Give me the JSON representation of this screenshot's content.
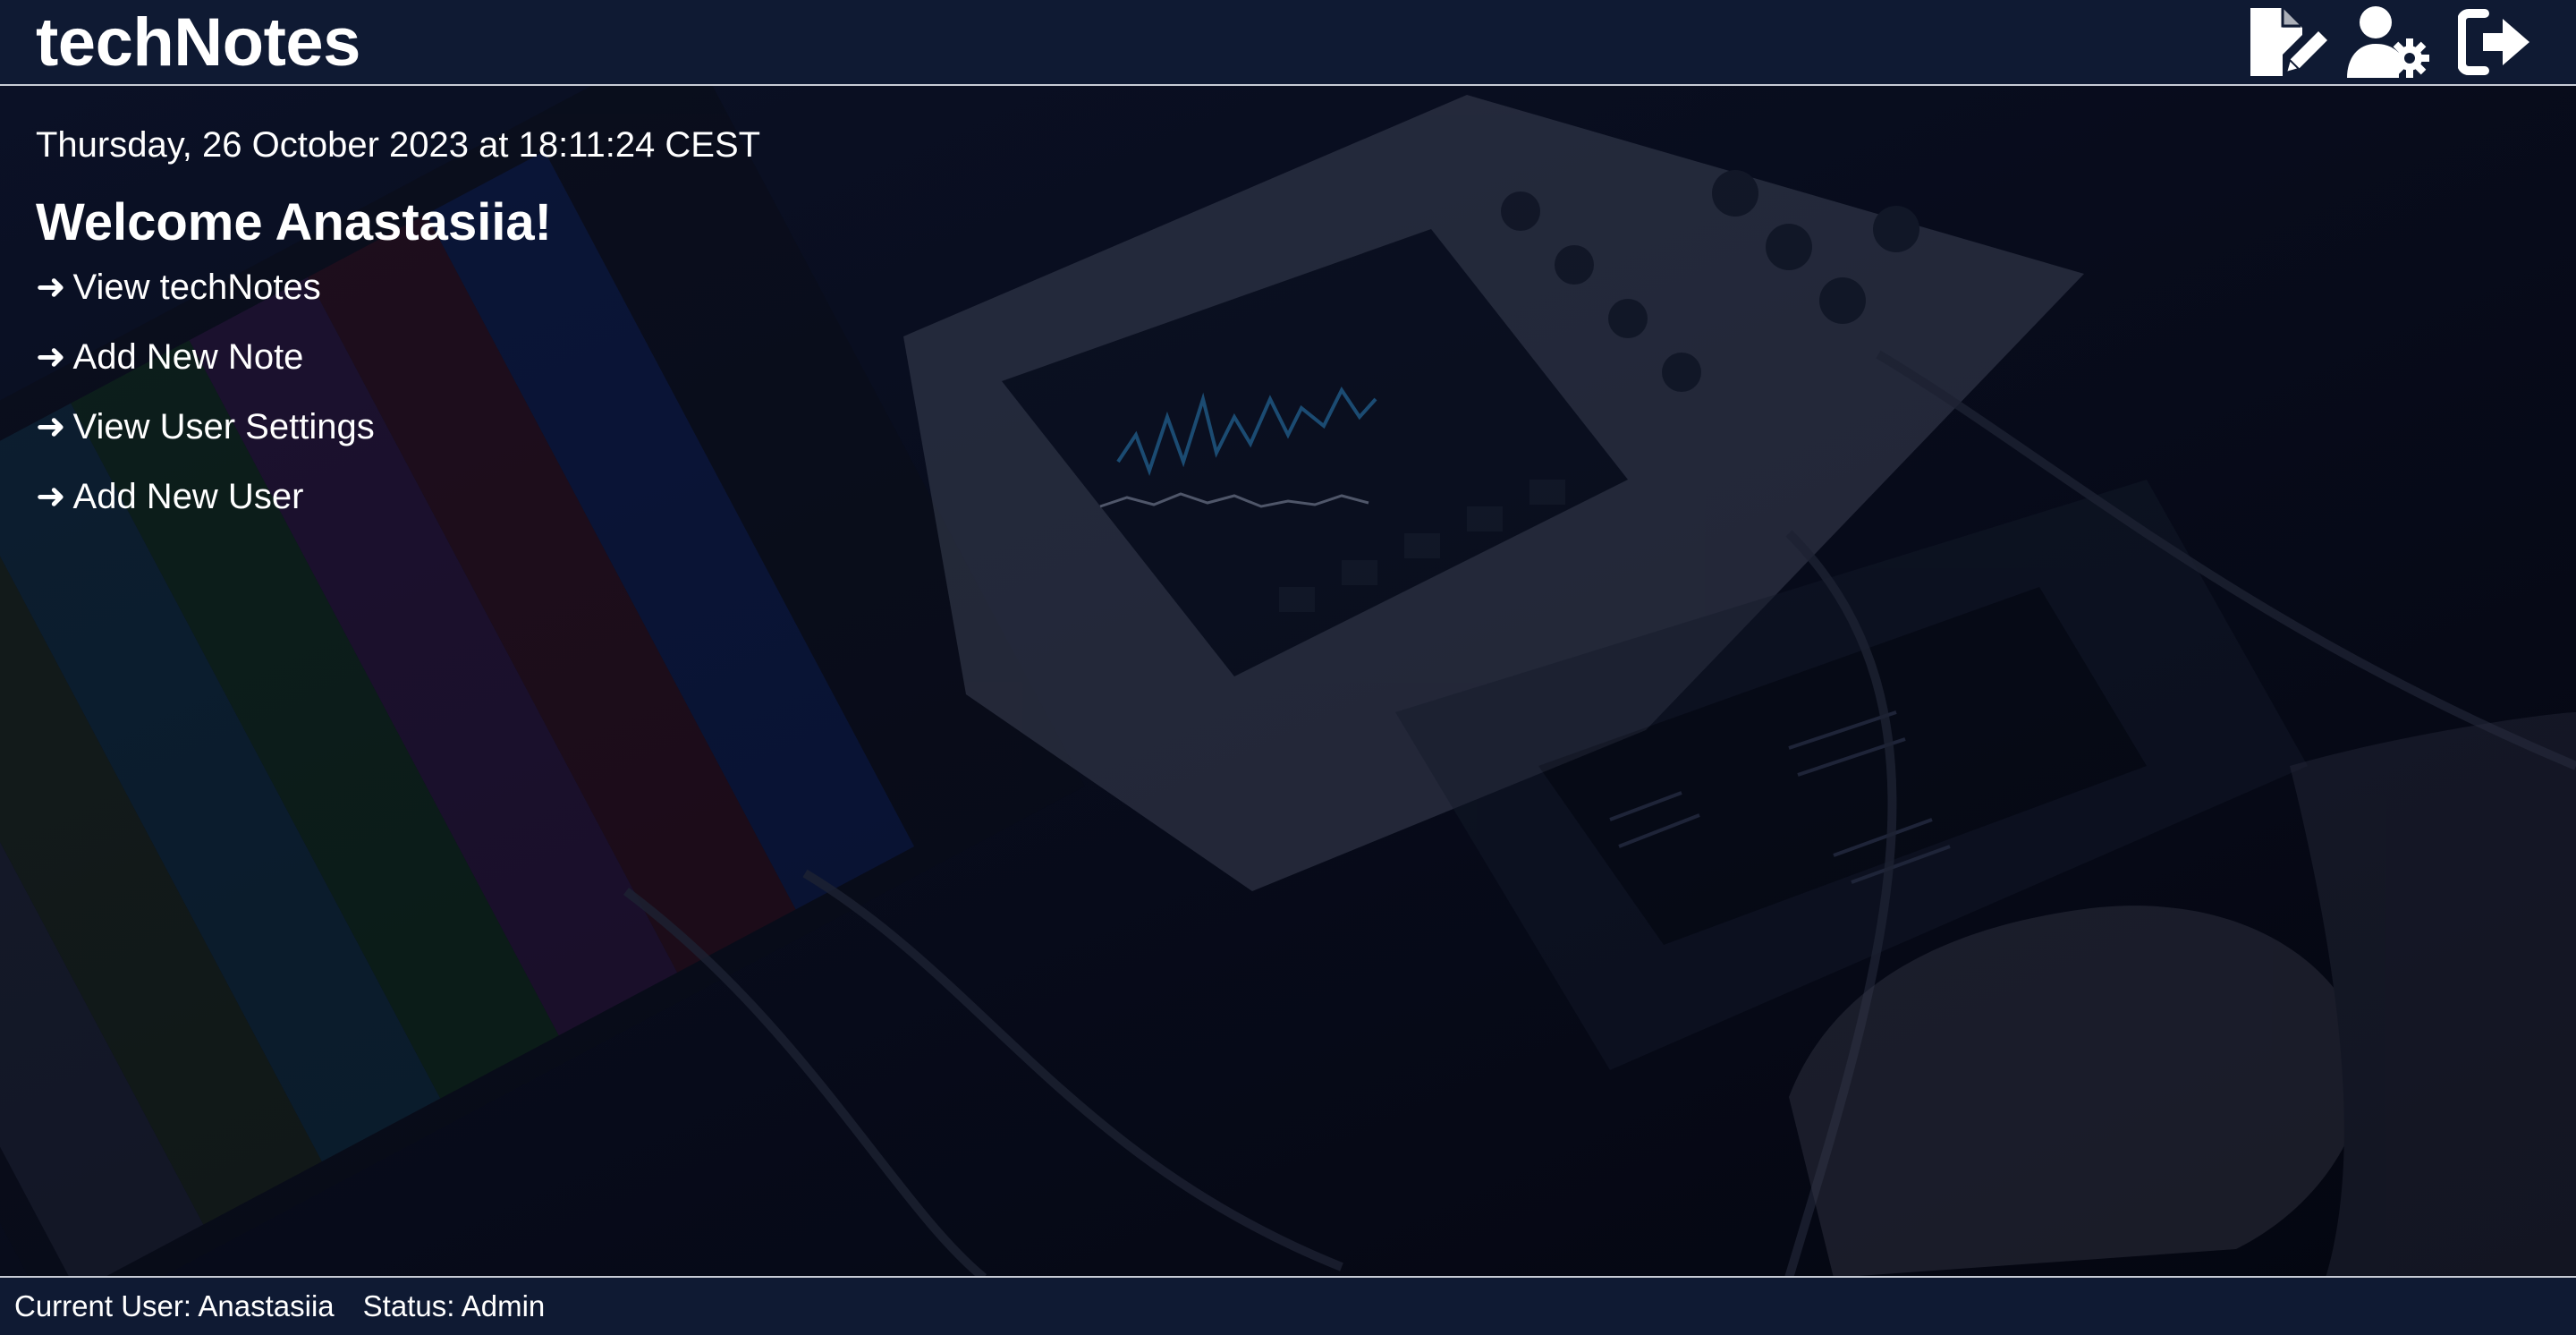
{
  "app": {
    "title": "techNotes"
  },
  "header": {
    "icons": {
      "new_note": "file-pen-icon",
      "user_settings": "user-gear-icon",
      "logout": "logout-icon"
    }
  },
  "main": {
    "datetime": "Thursday, 26 October 2023 at 18:11:24 CEST",
    "welcome": "Welcome Anastasiia!",
    "links": [
      {
        "arrow": "➜",
        "label": "View techNotes"
      },
      {
        "arrow": "➜",
        "label": "Add New Note"
      },
      {
        "arrow": "➜",
        "label": "View User Settings"
      },
      {
        "arrow": "➜",
        "label": "Add New User"
      }
    ]
  },
  "footer": {
    "current_user": "Current User: Anastasiia",
    "status": "Status: Admin"
  },
  "colors": {
    "header_bg": "#0f1a33",
    "footer_bg": "#0f1a33",
    "text": "#ffffff",
    "divider": "#c8ccd6"
  }
}
